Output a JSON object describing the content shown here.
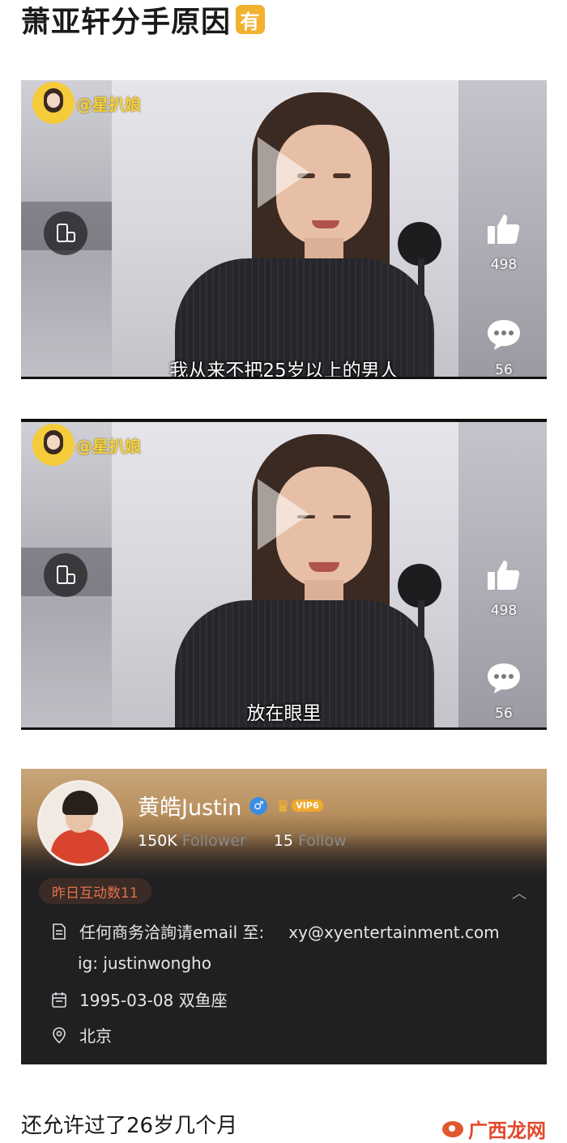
{
  "title": {
    "text": "萧亚轩分手原因",
    "badge": "有"
  },
  "videos": [
    {
      "watermark": "@星扒娘",
      "subtitle": "我从来不把25岁以上的男人",
      "likes": "498",
      "comments": "56",
      "icons": [
        "rotate-screen-icon",
        "thumbs-up-icon",
        "comment-icon",
        "play-icon"
      ]
    },
    {
      "watermark": "@星扒娘",
      "subtitle": "放在眼里",
      "likes": "498",
      "comments": "56",
      "icons": [
        "rotate-screen-icon",
        "thumbs-up-icon",
        "comment-icon",
        "play-icon"
      ]
    }
  ],
  "profile": {
    "name": "黄皓Justin",
    "gender_icon": "♂",
    "vip_label": "VIP6",
    "followers_count": "150K",
    "followers_label": "Follower",
    "follow_count": "15",
    "follow_label": "Follow",
    "interaction_badge": "昨日互动数11",
    "email_prefix": "任何商务洽詢请email 至:",
    "email": "xy@xyentertainment.com",
    "ig": "ig: justinwongho",
    "birthday": "1995-03-08 双鱼座",
    "location": "北京",
    "collapse_icon": "chevron-up-icon"
  },
  "caption": "还允许过了26岁几个月",
  "footer_watermark": {
    "site": "广西龙网"
  },
  "colors": {
    "badge": "#f2b12e",
    "profile_bg": "#202022",
    "interaction_text": "#e2724a",
    "footer_brand": "#e3482c"
  }
}
